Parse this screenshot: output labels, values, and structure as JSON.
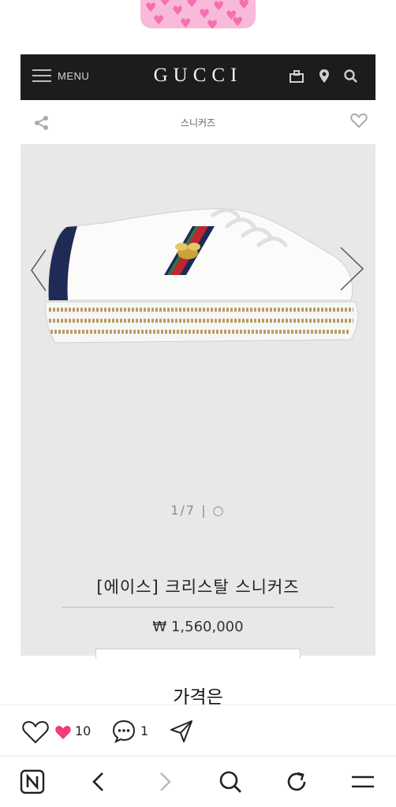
{
  "gucci": {
    "menu_label": "MENU",
    "brand": "GUCCI",
    "category": "스니커즈",
    "counter": "1/7 | ○",
    "product_name": "[에이스] 크리스탈 스니커즈",
    "price": "₩ 1,560,000"
  },
  "post": {
    "caption": "가격은",
    "likes": "10",
    "comments": "1"
  },
  "colors": {
    "header_bg": "#1c1c1c",
    "image_bg": "#e8e8e8",
    "heart_pink": "#f03c7e"
  },
  "icons": [
    "menu-icon",
    "bag-icon",
    "location-icon",
    "search-icon",
    "share-icon",
    "heart-icon",
    "chevron-left-icon",
    "chevron-right-icon",
    "comment-icon",
    "send-icon",
    "naver-icon",
    "back-icon",
    "forward-icon",
    "refresh-icon",
    "hamburger-icon"
  ]
}
